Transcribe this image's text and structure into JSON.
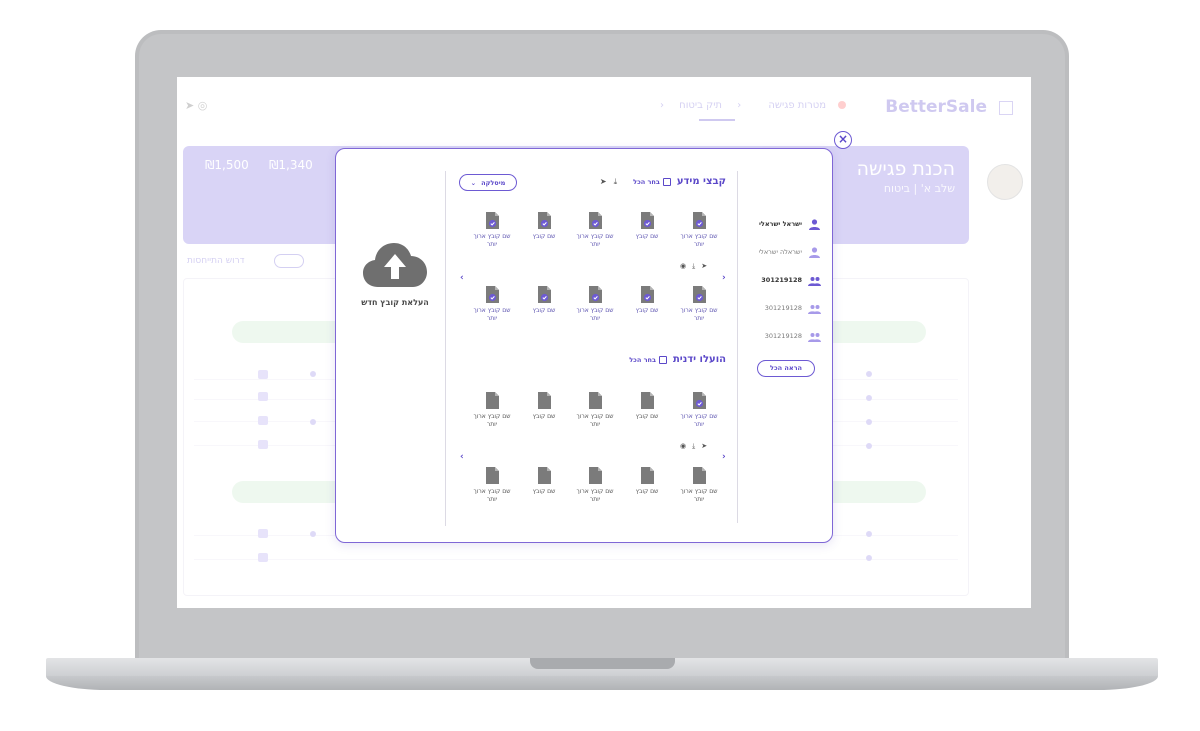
{
  "background_app": {
    "brand": "BetterSale",
    "breadcrumbs": [
      "תיק ביטוח",
      "מטרות פגישה"
    ],
    "banner": {
      "title": "הכנת פגישה",
      "subtitle": "שלב א' | ביטוח",
      "stat_1_value": "₪1,340",
      "stat_2_value": "₪1,500"
    },
    "toggle_label": "דרוש התייחסות"
  },
  "modal": {
    "close_label": "×",
    "upload_label": "העלאת קובץ חדש",
    "users": [
      {
        "label": "ישראל ישראלי",
        "style": "active"
      },
      {
        "label": "ישראלה ישראלי",
        "style": "dim"
      },
      {
        "label": "301219128",
        "style": "active"
      },
      {
        "label": "301219128",
        "style": "dim"
      },
      {
        "label": "301219128",
        "style": "dim"
      }
    ],
    "show_all_label": "הראה הכל",
    "knowledge_section": {
      "title": "קבצי מידע",
      "select_all_label": "בחר הכל",
      "dropdown_label": "מיסלקה"
    },
    "manual_section": {
      "title": "הועלו ידנית",
      "select_all_label": "בחר הכל"
    },
    "file_labels": {
      "name": "שם קובץ",
      "name_long": "שם קובץ ארוך יותר"
    }
  },
  "colors": {
    "accent": "#5b48c9",
    "file_icon": "#7b7b7b",
    "check_badge": "#6d5ad3"
  },
  "icons": [
    "close-icon",
    "cloud-upload-icon",
    "user-icon",
    "users-icon",
    "send-icon",
    "download-icon",
    "eye-icon",
    "chevron-left-icon",
    "chevron-right-icon",
    "chevron-down-icon",
    "file-icon",
    "check-badge-icon"
  ]
}
